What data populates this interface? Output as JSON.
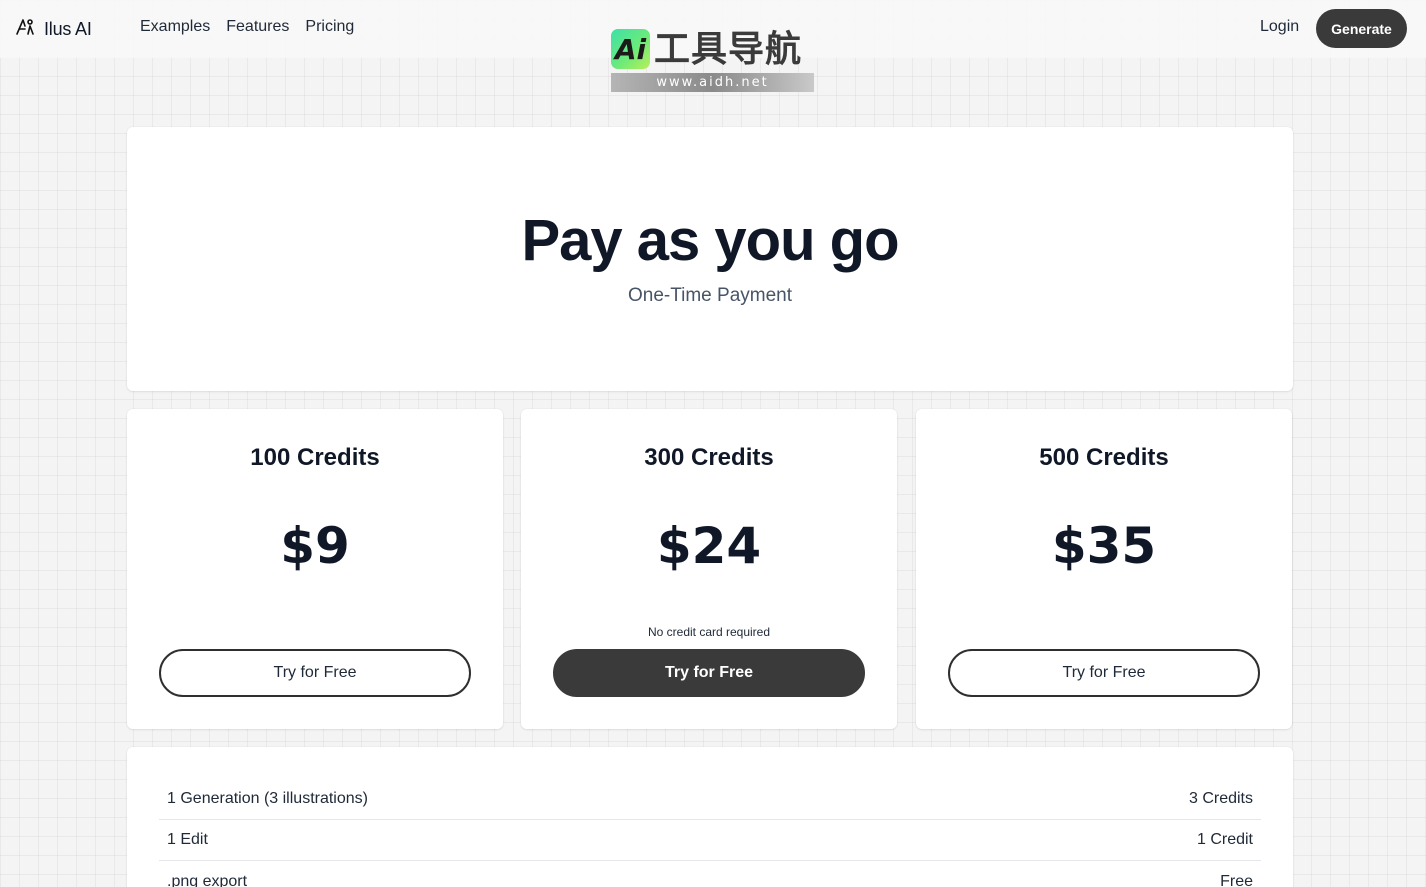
{
  "nav": {
    "brand": "Ilus AI",
    "links": [
      "Examples",
      "Features",
      "Pricing"
    ],
    "login": "Login",
    "generate": "Generate"
  },
  "watermark": {
    "badge": "Ai",
    "title": "工具导航",
    "url": "www.aidh.net"
  },
  "hero": {
    "title": "Pay as you go",
    "subtitle": "One-Time Payment"
  },
  "plans": [
    {
      "name": "100 Credits",
      "price": "$9",
      "note": "",
      "cta": "Try for Free"
    },
    {
      "name": "300 Credits",
      "price": "$24",
      "note": "No credit card required",
      "cta": "Try for Free"
    },
    {
      "name": "500 Credits",
      "price": "$35",
      "note": "",
      "cta": "Try for Free"
    }
  ],
  "costs": [
    {
      "item": "1 Generation (3 illustrations)",
      "cost": "3 Credits"
    },
    {
      "item": "1 Edit",
      "cost": "1 Credit"
    },
    {
      "item": ".png export",
      "cost": "Free"
    }
  ],
  "colors": {
    "primary_button": "#3a3a3a",
    "page_background": "#f4f4f4",
    "text": "#101828"
  }
}
